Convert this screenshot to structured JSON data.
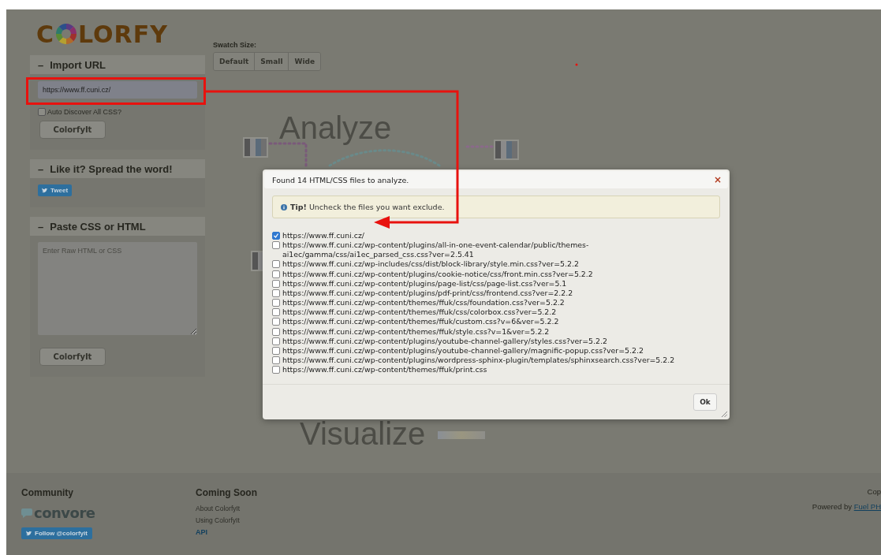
{
  "logo": {
    "parts": [
      "C",
      "LORFY"
    ]
  },
  "sidebar": {
    "panels": [
      {
        "kind": "import",
        "toggle": "–",
        "title": "Import URL",
        "url": "https://www.ff.cuni.cz/",
        "checkbox": {
          "label": "Auto Discover All CSS?",
          "checked": false
        },
        "button": "ColorfyIt"
      },
      {
        "kind": "share",
        "toggle": "–",
        "title": "Like it? Spread the word!",
        "button": "Tweet"
      },
      {
        "kind": "paste",
        "toggle": "–",
        "title": "Paste CSS or HTML",
        "placeholder": "Enter Raw HTML or CSS",
        "button": "ColorfyIt"
      }
    ]
  },
  "swatch_size": {
    "label": "Swatch Size:",
    "options": [
      {
        "label": "Default"
      },
      {
        "label": "Small"
      },
      {
        "label": "Wide"
      }
    ]
  },
  "illustration": {
    "captions": [
      "Analyze",
      "Visualize"
    ]
  },
  "dialog": {
    "title": "Found 14 HTML/CSS files to analyze.",
    "close": "×",
    "tip": "**Tip!** Uncheck the files you want exclude.",
    "files": [
      {
        "url": "https://www.ff.cuni.cz/",
        "checked": true
      },
      {
        "url": "https://www.ff.cuni.cz/wp-content/plugins/all-in-one-event-calendar/public/themes-ai1ec/gamma/css/ai1ec_parsed_css.css?ver=2.5.41",
        "checked": false
      },
      {
        "url": "https://www.ff.cuni.cz/wp-includes/css/dist/block-library/style.min.css?ver=5.2.2",
        "checked": false
      },
      {
        "url": "https://www.ff.cuni.cz/wp-content/plugins/cookie-notice/css/front.min.css?ver=5.2.2",
        "checked": false
      },
      {
        "url": "https://www.ff.cuni.cz/wp-content/plugins/page-list/css/page-list.css?ver=5.1",
        "checked": false
      },
      {
        "url": "https://www.ff.cuni.cz/wp-content/plugins/pdf-print/css/frontend.css?ver=2.2.2",
        "checked": false
      },
      {
        "url": "https://www.ff.cuni.cz/wp-content/themes/ffuk/css/foundation.css?ver=5.2.2",
        "checked": false
      },
      {
        "url": "https://www.ff.cuni.cz/wp-content/themes/ffuk/css/colorbox.css?ver=5.2.2",
        "checked": false
      },
      {
        "url": "https://www.ff.cuni.cz/wp-content/themes/ffuk/custom.css?v=6&ver=5.2.2",
        "checked": false
      },
      {
        "url": "https://www.ff.cuni.cz/wp-content/themes/ffuk/style.css?v=1&ver=5.2.2",
        "checked": false
      },
      {
        "url": "https://www.ff.cuni.cz/wp-content/plugins/youtube-channel-gallery/styles.css?ver=5.2.2",
        "checked": false
      },
      {
        "url": "https://www.ff.cuni.cz/wp-content/plugins/youtube-channel-gallery/magnific-popup.css?ver=5.2.2",
        "checked": false
      },
      {
        "url": "https://www.ff.cuni.cz/wp-content/plugins/wordpress-sphinx-plugin/templates/sphinxsearch.css?ver=5.2.2",
        "checked": false
      },
      {
        "url": "https://www.ff.cuni.cz/wp-content/themes/ffuk/print.css",
        "checked": false
      }
    ],
    "ok": "Ok"
  },
  "footer": {
    "community": {
      "heading": "Community",
      "logo": "convore",
      "follow": "Follow @colorfyit"
    },
    "coming_soon": {
      "heading": "Coming Soon",
      "links": [
        {
          "label": "About ColorfyIt",
          "kind": "plain"
        },
        {
          "label": "Using ColorfyIt",
          "kind": "plain"
        },
        {
          "label": "API",
          "kind": "link"
        }
      ]
    },
    "right": {
      "copyright": "Cop",
      "powered_by": "Powered by",
      "link": "Fuel PH"
    }
  }
}
